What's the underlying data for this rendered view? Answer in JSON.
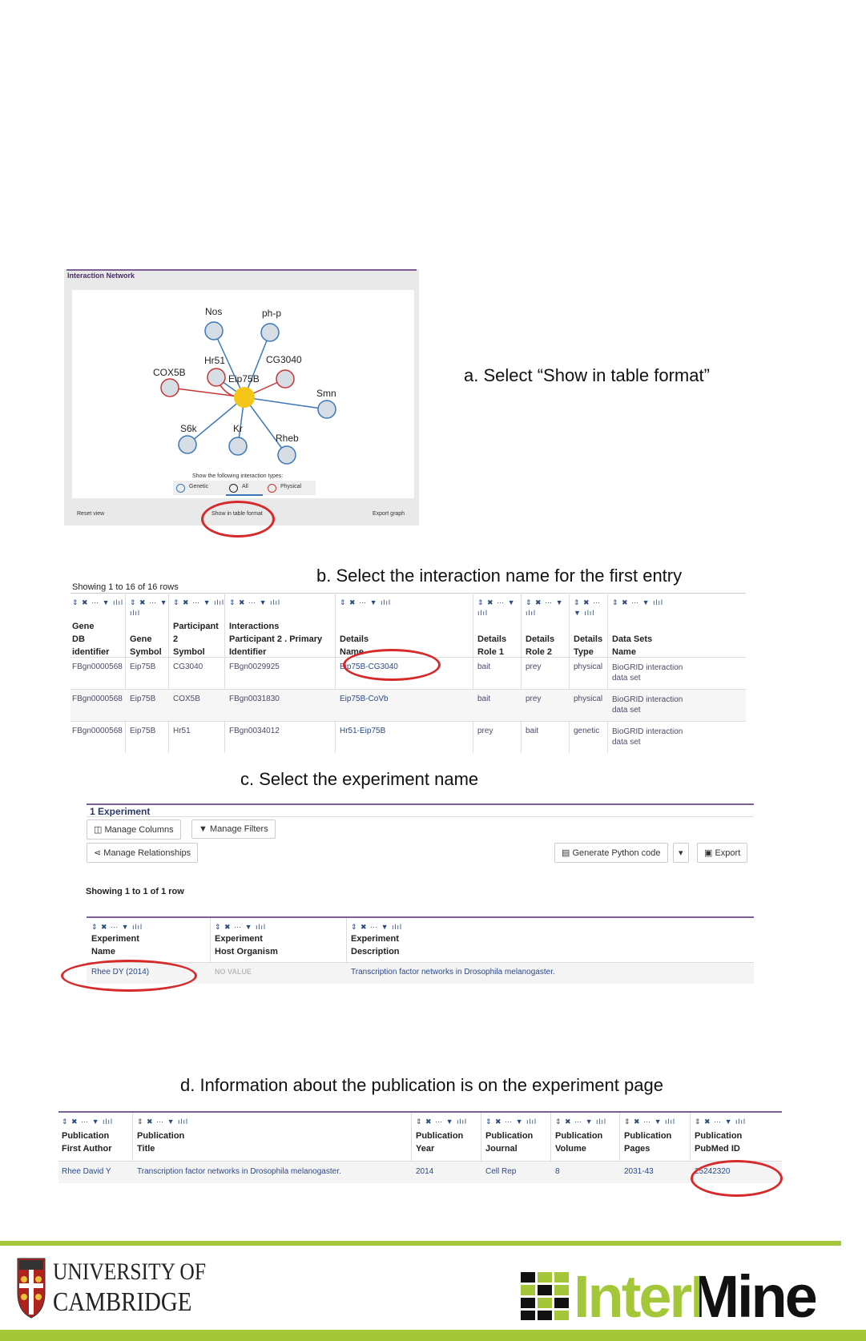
{
  "steps": {
    "a": "a. Select “Show in table format”",
    "b": "b. Select the interaction name for the first entry",
    "c": "c. Select the experiment name",
    "d": "d. Information about the publication is on the experiment page"
  },
  "network": {
    "title": "Interaction Network",
    "nodes": [
      "Nos",
      "ph-p",
      "Hr51",
      "CG3040",
      "COX5B",
      "Eip75B",
      "Smn",
      "S6k",
      "Kr",
      "Rheb"
    ],
    "types_label": "Show the following interaction types:",
    "types": [
      "Genetic",
      "All",
      "Physical"
    ],
    "footer": {
      "reset": "Reset view",
      "table": "Show in table format",
      "export": "Export graph"
    }
  },
  "interactions_table": {
    "showing": "Showing 1 to 16 of 16 rows",
    "headers": [
      {
        "icons": "⇕ ✖ ⋯ ▼ ılıl",
        "label": "Gene\nDB\nidentifier"
      },
      {
        "icons": "⇕ ✖ ⋯ ▼\nılıl",
        "label": "Gene\nSymbol"
      },
      {
        "icons": "⇕ ✖ ⋯ ▼ ılıl",
        "label": "Participant\n2\nSymbol"
      },
      {
        "icons": "⇕ ✖ ⋯ ▼ ılıl",
        "label": "Interactions\nParticipant 2 . Primary\nIdentifier"
      },
      {
        "icons": "⇕ ✖ ⋯ ▼ ılıl",
        "label": "Details\nName"
      },
      {
        "icons": "⇕ ✖ ⋯ ▼\nılıl",
        "label": "Details\nRole 1"
      },
      {
        "icons": "⇕ ✖ ⋯ ▼\nılıl",
        "label": "Details\nRole 2"
      },
      {
        "icons": "⇕ ✖ ⋯\n▼ ılıl",
        "label": "Details\nType"
      },
      {
        "icons": "⇕ ✖ ⋯ ▼ ılıl",
        "label": "Data Sets\nName"
      }
    ],
    "rows": [
      [
        "FBgn0000568",
        "Eip75B",
        "CG3040",
        "FBgn0029925",
        "Eip75B-CG3040",
        "bait",
        "prey",
        "physical",
        "BioGRID interaction data set"
      ],
      [
        "FBgn0000568",
        "Eip75B",
        "COX5B",
        "FBgn0031830",
        "Eip75B-CoVb",
        "bait",
        "prey",
        "physical",
        "BioGRID interaction data set"
      ],
      [
        "FBgn0000568",
        "Eip75B",
        "Hr51",
        "FBgn0034012",
        "Hr51-Eip75B",
        "prey",
        "bait",
        "genetic",
        "BioGRID interaction data set"
      ]
    ]
  },
  "experiment": {
    "title": "1 Experiment",
    "buttons": {
      "manage_columns": "Manage Columns",
      "manage_filters": "Manage Filters",
      "manage_relationships": "Manage Relationships",
      "python": "Generate Python code",
      "export": "Export"
    },
    "showing": "Showing 1 to 1 of 1 row",
    "icons": "⇕ ✖ ⋯ ▼ ılıl",
    "headers": [
      "Experiment\nName",
      "Experiment\nHost Organism",
      "Experiment\nDescription"
    ],
    "row": [
      "Rhee DY (2014)",
      "NO VALUE",
      "Transcription factor networks in Drosophila melanogaster."
    ]
  },
  "publication": {
    "icons": "⇕ ✖ ⋯ ▼ ılıl",
    "headers": [
      "Publication\nFirst Author",
      "Publication\nTitle",
      "Publication\nYear",
      "Publication\nJournal",
      "Publication\nVolume",
      "Publication\nPages",
      "Publication\nPubMed ID"
    ],
    "row": [
      "Rhee David Y",
      "Transcription factor networks in Drosophila melanogaster.",
      "2014",
      "Cell Rep",
      "8",
      "2031-43",
      "25242320"
    ]
  },
  "footer": {
    "cambridge_line1": "UNIVERSITY OF",
    "cambridge_line2": "CAMBRIDGE",
    "intermine": "InterMine",
    "accent": "#a4c639"
  }
}
